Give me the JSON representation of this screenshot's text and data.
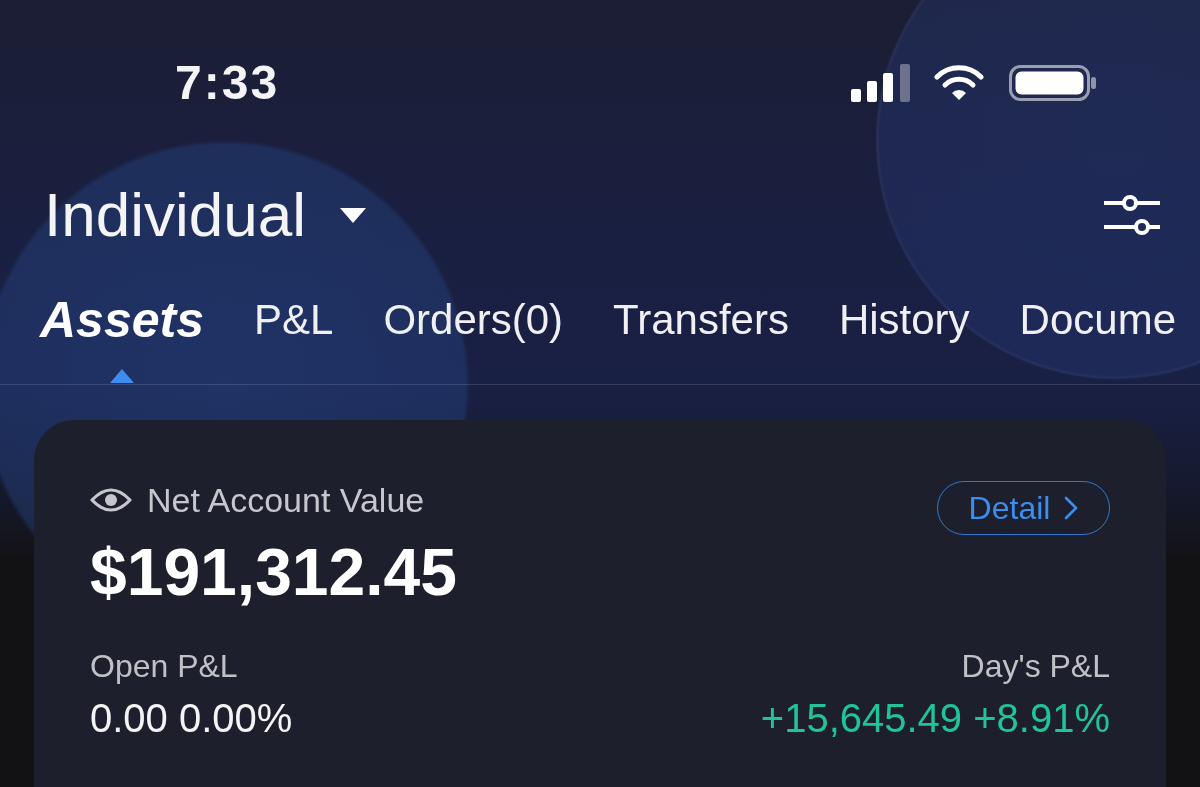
{
  "status_bar": {
    "time": "7:33"
  },
  "header": {
    "account": "Individual"
  },
  "tabs": [
    {
      "label": "Assets",
      "selected": true
    },
    {
      "label": "P&L",
      "selected": false
    },
    {
      "label": "Orders(0)",
      "selected": false
    },
    {
      "label": "Transfers",
      "selected": false
    },
    {
      "label": "History",
      "selected": false
    },
    {
      "label": "Docume",
      "selected": false
    }
  ],
  "summary": {
    "label": "Net Account Value",
    "value": "$191,312.45",
    "detail_button": "Detail",
    "metrics": [
      {
        "label": "Open P&L",
        "value": "0.00 0.00%",
        "color": "#f4f4f6"
      },
      {
        "label": "Day's P&L",
        "value": "+15,645.49 +8.91%",
        "color": "#1fc49b"
      }
    ]
  }
}
